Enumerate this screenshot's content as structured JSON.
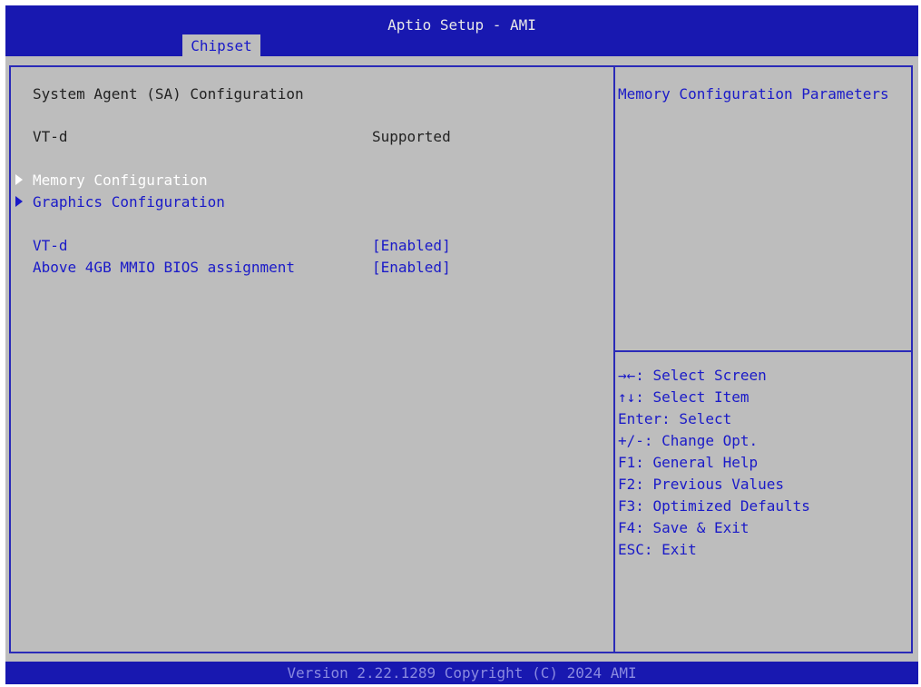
{
  "window": {
    "title": "Aptio Setup - AMI",
    "active_tab": "Chipset"
  },
  "main": {
    "section_title": "System Agent (SA) Configuration",
    "info_row": {
      "label": "VT-d",
      "value": "Supported"
    },
    "submenus": [
      {
        "label": "Memory Configuration",
        "selected": true
      },
      {
        "label": "Graphics Configuration",
        "selected": false
      }
    ],
    "options": [
      {
        "label": "VT-d",
        "value": "[Enabled]"
      },
      {
        "label": "Above 4GB MMIO BIOS assignment",
        "value": "[Enabled]"
      }
    ]
  },
  "help": {
    "description": "Memory Configuration Parameters",
    "keys": [
      "→←: Select Screen",
      "↑↓: Select Item",
      "Enter: Select",
      "+/-: Change Opt.",
      "F1: General Help",
      "F2: Previous Values",
      "F3: Optimized Defaults",
      "F4: Save & Exit",
      "ESC: Exit"
    ]
  },
  "footer": {
    "version": "Version 2.22.1289 Copyright (C) 2024 AMI"
  },
  "colors": {
    "background": "#0a0aa8",
    "panel": "#bdbdbd",
    "text_blue": "#1a1ac8",
    "selected": "#ffffff"
  }
}
